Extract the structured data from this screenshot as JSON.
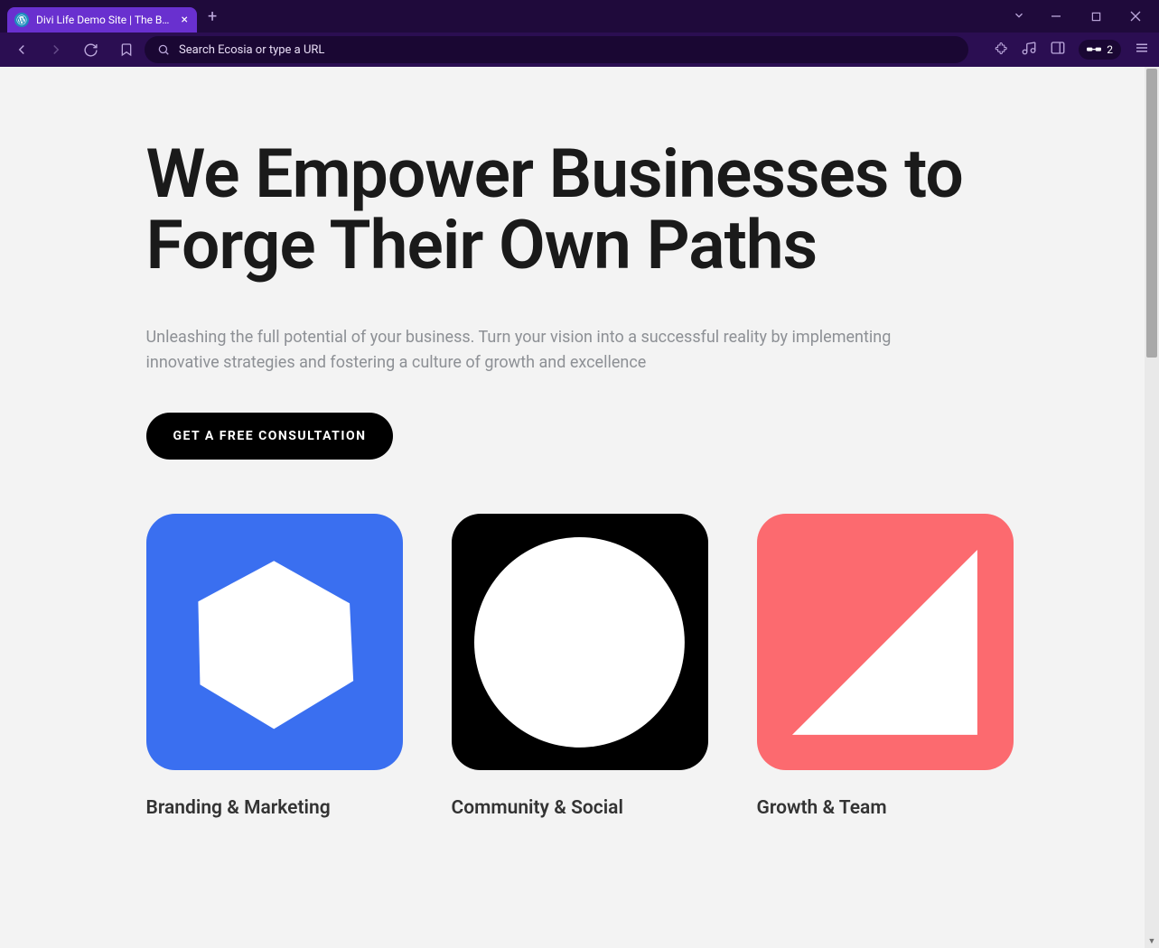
{
  "browser": {
    "tab_title": "Divi Life Demo Site | The Best D",
    "address_placeholder": "Search Ecosia or type a URL",
    "badge_count": "2"
  },
  "page": {
    "heading": "We Empower Businesses to Forge Their Own Paths",
    "subtext": "Unleashing the full potential of your business. Turn your vision into a successful reality by implementing innovative strategies and fostering a culture of growth and excellence",
    "cta_label": "GET A FREE CONSULTATION",
    "cards": [
      {
        "title": "Branding & Marketing",
        "icon": "hexagon",
        "color": "#3a6ff0"
      },
      {
        "title": "Community & Social",
        "icon": "circle",
        "color": "#000000"
      },
      {
        "title": "Growth & Team",
        "icon": "triangle",
        "color": "#fc6a6f"
      }
    ]
  }
}
